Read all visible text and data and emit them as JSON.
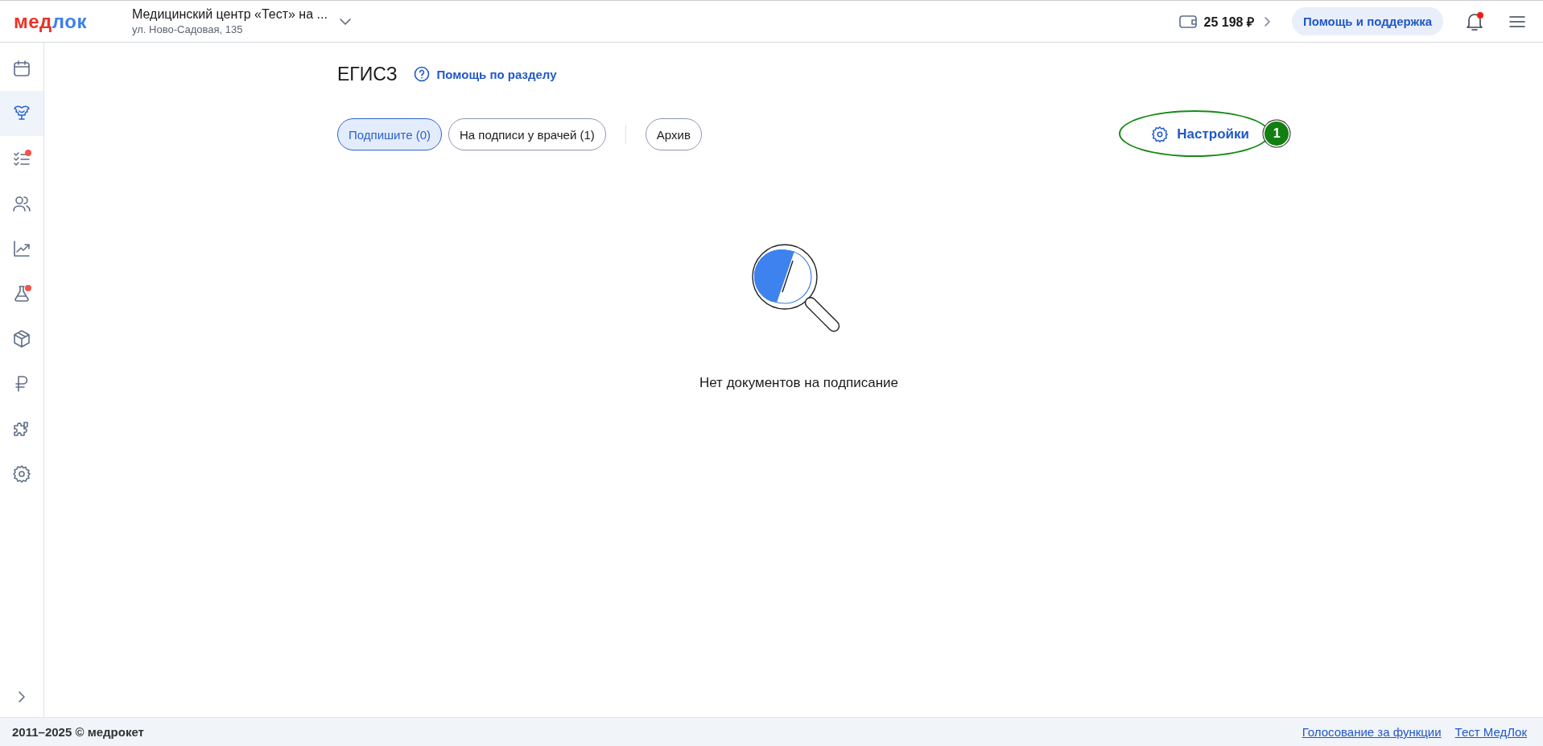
{
  "header": {
    "logo": [
      {
        "text": "мед",
        "color": "#ee3124"
      },
      {
        "text": "лок",
        "color": "#3d7fe6"
      }
    ],
    "clinic_name": "Медицинский центр «Тест» на ...",
    "clinic_address": "ул. Ново-Садовая, 135",
    "balance": "25 198 ₽",
    "support_button": "Помощь и поддержка",
    "notifications_unread": true
  },
  "sidebar": {
    "items": [
      {
        "kind": "calendar",
        "selected": false,
        "badge": false
      },
      {
        "kind": "emblem",
        "selected": true,
        "badge": false
      },
      {
        "kind": "checklist",
        "selected": false,
        "badge": true
      },
      {
        "kind": "users",
        "selected": false,
        "badge": false
      },
      {
        "kind": "chart",
        "selected": false,
        "badge": false
      },
      {
        "kind": "flask",
        "selected": false,
        "badge": true
      },
      {
        "kind": "box",
        "selected": false,
        "badge": false
      },
      {
        "kind": "ruble",
        "selected": false,
        "badge": false
      },
      {
        "kind": "puzzle",
        "selected": false,
        "badge": false
      },
      {
        "kind": "settings",
        "selected": false,
        "badge": false
      }
    ]
  },
  "page": {
    "title": "ЕГИСЗ",
    "help_link": "Помощь по разделу",
    "tabs": [
      {
        "label": "Подпишите (0)",
        "selected": true
      },
      {
        "label": "На подписи у врачей (1)",
        "selected": false
      },
      {
        "label": "Архив",
        "selected": false,
        "separated": true
      }
    ],
    "settings_button": "Настройки",
    "annotation": {
      "label": "1"
    },
    "empty_message": "Нет документов на подписание"
  },
  "footer": {
    "copyright": "2011–2025 © медрокет",
    "links": [
      "Голосование за функции",
      "Тест МедЛок"
    ]
  }
}
